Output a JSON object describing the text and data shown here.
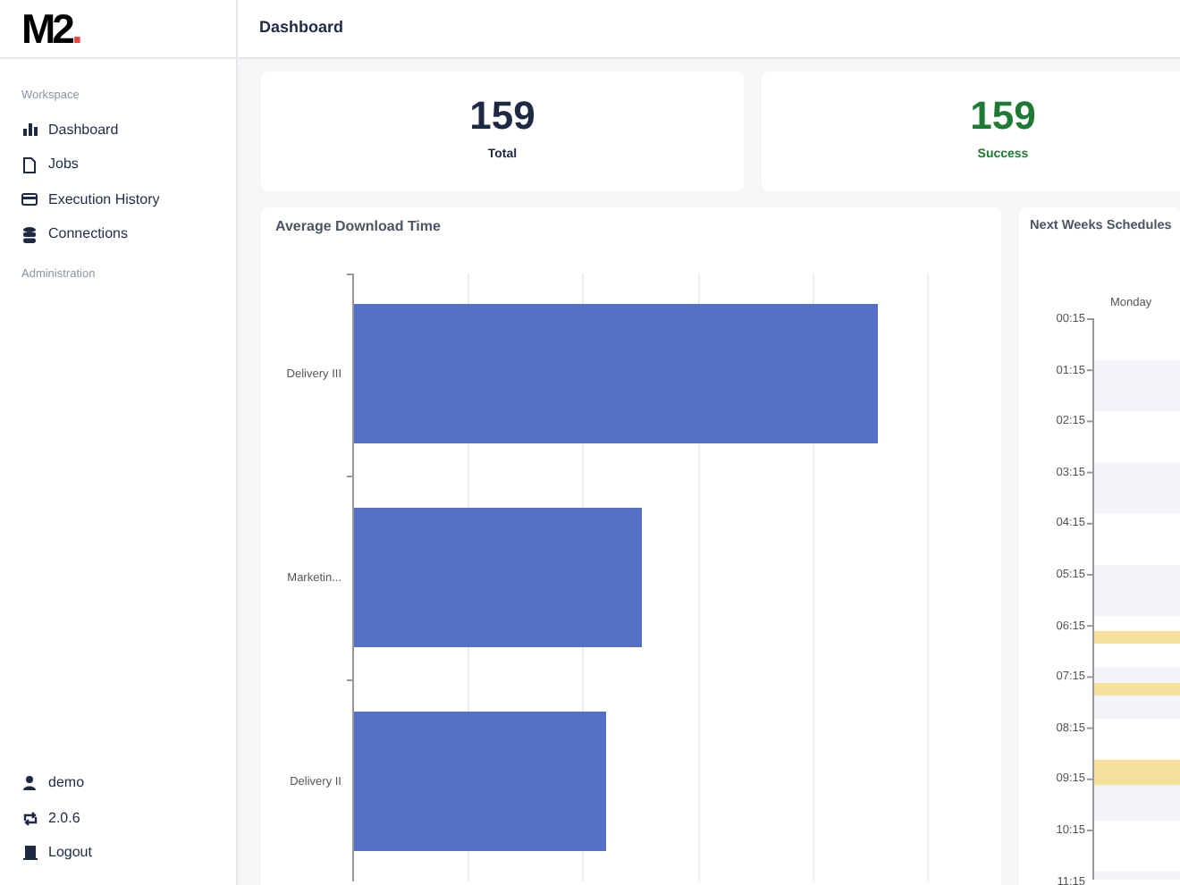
{
  "logo": {
    "text": "M2",
    "dot": "."
  },
  "sidebar": {
    "sections": [
      {
        "title": "Workspace",
        "items": [
          {
            "label": "Dashboard"
          },
          {
            "label": "Jobs"
          },
          {
            "label": "Execution History"
          },
          {
            "label": "Connections"
          }
        ]
      },
      {
        "title": "Administration"
      }
    ],
    "footer": [
      {
        "label": "demo"
      },
      {
        "label": "2.0.6"
      },
      {
        "label": "Logout"
      }
    ]
  },
  "header": {
    "title": "Dashboard"
  },
  "stats": [
    {
      "value": "159",
      "label": "Total",
      "kind": "neutral"
    },
    {
      "value": "159",
      "label": "Success",
      "kind": "success"
    }
  ],
  "download_chart": {
    "title": "Average Download Time",
    "categories": [
      "Delivery III",
      "Marketin...",
      "Delivery II"
    ]
  },
  "schedule": {
    "title": "Next Weeks Schedules",
    "day": "Monday",
    "hours": [
      "00:15",
      "01:15",
      "02:15",
      "03:15",
      "04:15",
      "05:15",
      "06:15",
      "07:15",
      "08:15",
      "09:15",
      "10:15",
      "11:15"
    ]
  }
}
